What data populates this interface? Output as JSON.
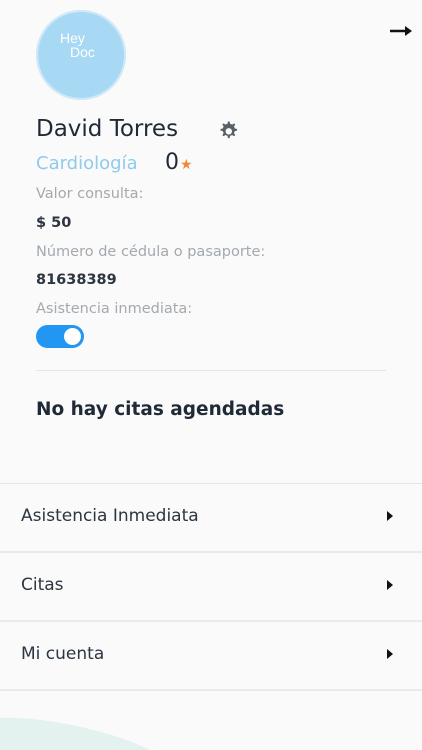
{
  "header": {
    "exit_icon": "arrow-right-icon"
  },
  "profile": {
    "avatar_logo_line1": "Hey",
    "avatar_logo_line2": "Doc",
    "name": "David Torres",
    "settings_icon": "gear-icon",
    "specialty": "Cardiología",
    "rating": "0",
    "rating_icon": "star-icon",
    "fee_label": "Valor consulta:",
    "fee_value": "$ 50",
    "id_label": "Número de cédula o pasaporte:",
    "id_value": "81638389",
    "immediate_label": "Asistencia inmediata:",
    "immediate_enabled": true
  },
  "appointments": {
    "empty_text": "No hay citas agendadas"
  },
  "menu": {
    "items": [
      {
        "label": "Asistencia Inmediata"
      },
      {
        "label": "Citas"
      },
      {
        "label": "Mi cuenta"
      }
    ]
  },
  "colors": {
    "accent": "#2196f3",
    "specialty": "#8fcbeb",
    "star": "#f0883a",
    "avatar": "#a8d9f4"
  }
}
